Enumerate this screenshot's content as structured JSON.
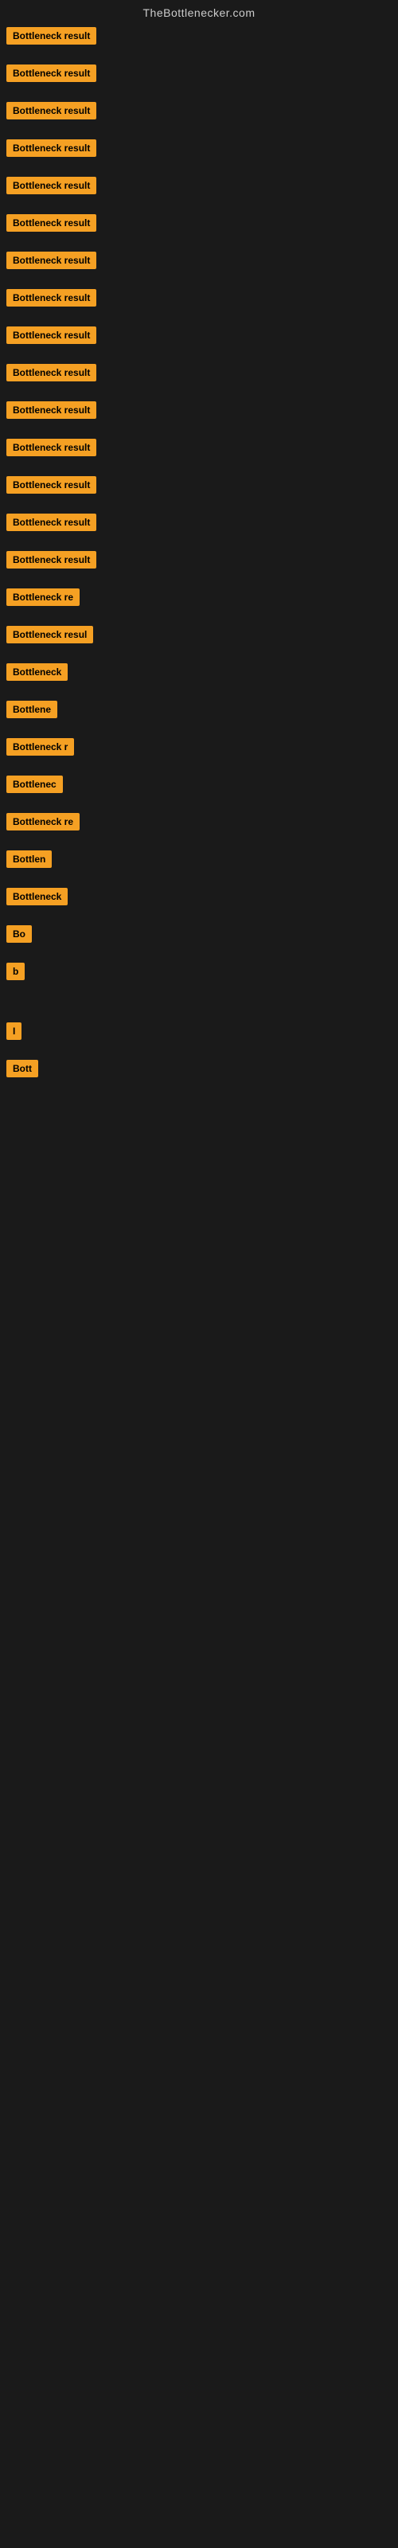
{
  "site": {
    "title": "TheBottlenecker.com"
  },
  "rows": [
    {
      "label": "Bottleneck result",
      "width": 130,
      "fontSize": 12
    },
    {
      "label": "Bottleneck result",
      "width": 130,
      "fontSize": 12
    },
    {
      "label": "Bottleneck result",
      "width": 130,
      "fontSize": 12
    },
    {
      "label": "Bottleneck result",
      "width": 130,
      "fontSize": 12
    },
    {
      "label": "Bottleneck result",
      "width": 130,
      "fontSize": 12
    },
    {
      "label": "Bottleneck result",
      "width": 130,
      "fontSize": 12
    },
    {
      "label": "Bottleneck result",
      "width": 130,
      "fontSize": 12
    },
    {
      "label": "Bottleneck result",
      "width": 130,
      "fontSize": 12
    },
    {
      "label": "Bottleneck result",
      "width": 130,
      "fontSize": 12
    },
    {
      "label": "Bottleneck result",
      "width": 130,
      "fontSize": 12
    },
    {
      "label": "Bottleneck result",
      "width": 130,
      "fontSize": 12
    },
    {
      "label": "Bottleneck result",
      "width": 130,
      "fontSize": 12
    },
    {
      "label": "Bottleneck result",
      "width": 130,
      "fontSize": 12
    },
    {
      "label": "Bottleneck result",
      "width": 130,
      "fontSize": 12
    },
    {
      "label": "Bottleneck result",
      "width": 130,
      "fontSize": 12
    },
    {
      "label": "Bottleneck re",
      "width": 105,
      "fontSize": 12
    },
    {
      "label": "Bottleneck resul",
      "width": 115,
      "fontSize": 12
    },
    {
      "label": "Bottleneck",
      "width": 85,
      "fontSize": 12
    },
    {
      "label": "Bottlene",
      "width": 70,
      "fontSize": 12
    },
    {
      "label": "Bottleneck r",
      "width": 93,
      "fontSize": 12
    },
    {
      "label": "Bottlenec",
      "width": 78,
      "fontSize": 12
    },
    {
      "label": "Bottleneck re",
      "width": 103,
      "fontSize": 12
    },
    {
      "label": "Bottlen",
      "width": 65,
      "fontSize": 12
    },
    {
      "label": "Bottleneck",
      "width": 83,
      "fontSize": 12
    },
    {
      "label": "Bo",
      "width": 28,
      "fontSize": 12
    },
    {
      "label": "b",
      "width": 14,
      "fontSize": 12
    },
    {
      "label": "",
      "width": 0,
      "fontSize": 12
    },
    {
      "label": "I",
      "width": 8,
      "fontSize": 12
    },
    {
      "label": "Bott",
      "width": 35,
      "fontSize": 12
    }
  ]
}
